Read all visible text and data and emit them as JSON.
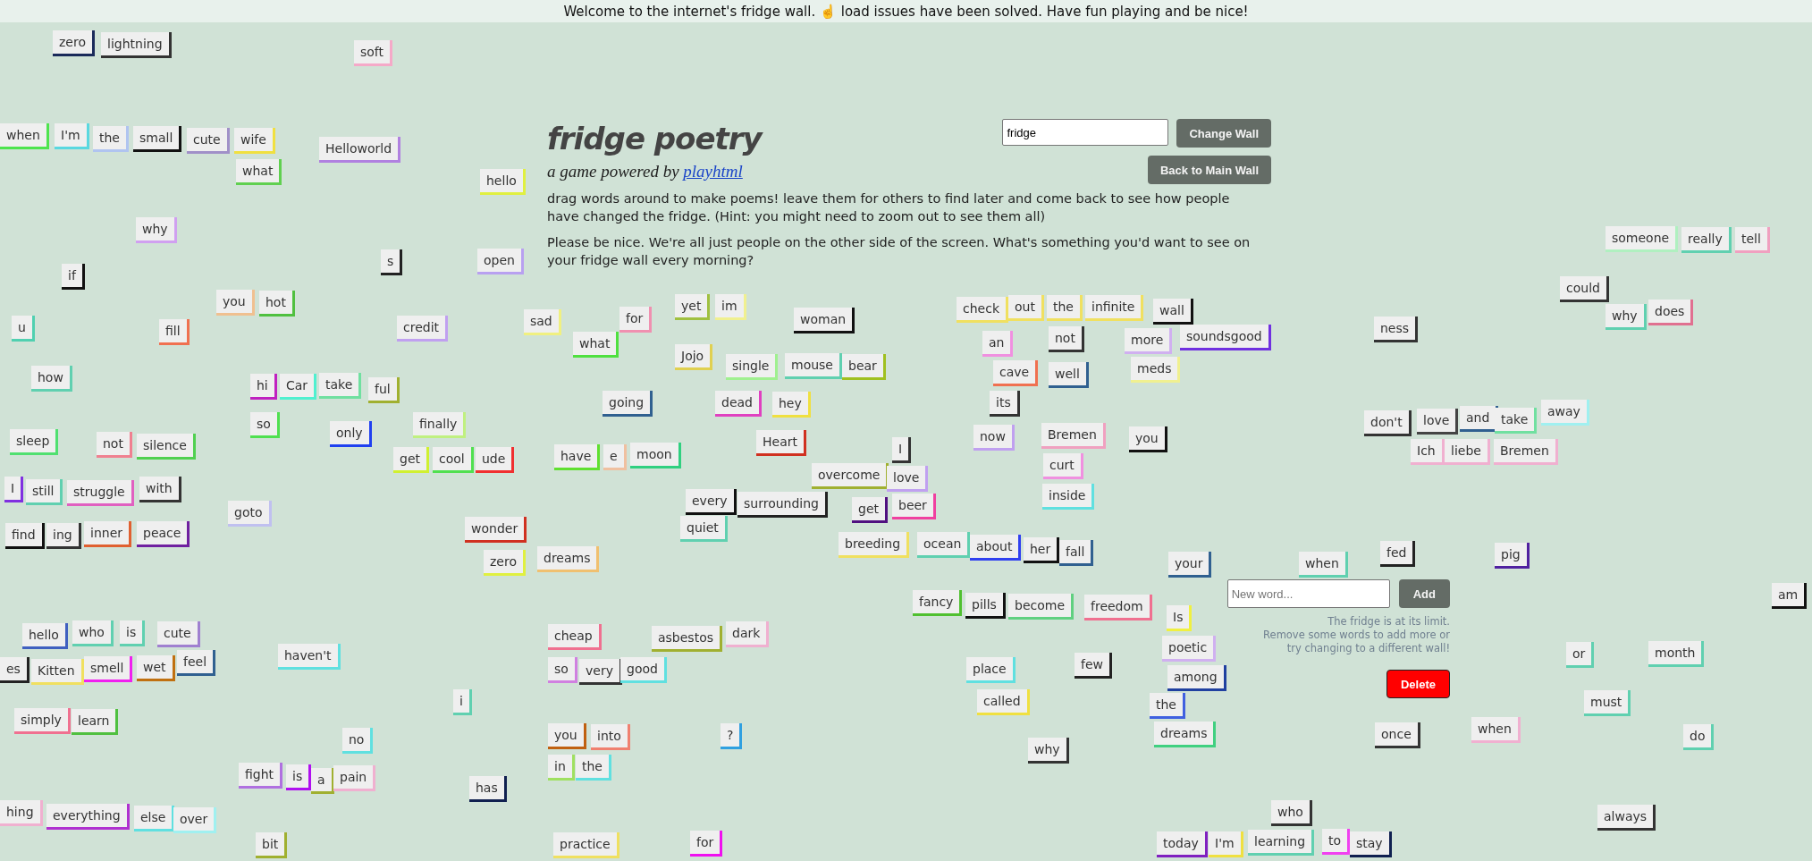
{
  "banner": "Welcome to the internet's fridge wall. ☝️ load issues have been solved. Have fun playing and be nice!",
  "intro": {
    "title": "fridge poetry",
    "subtitle": "a game powered by ",
    "link": "playhtml",
    "paragraphs": [
      "drag words around to make poems! leave them for others to find later and come back to see how people have changed the fridge. (Hint: you might need to zoom out to see them all)",
      "Please be nice. We're all just people on the other side of the screen. What's something you'd want to see on your fridge wall every morning?"
    ]
  },
  "wall_controls": {
    "wall_value": "fridge",
    "change_button": "Change Wall",
    "main_button": "Back to Main Wall"
  },
  "words": [
    {
      "text": "zero",
      "color": "#1a2a5a"
    },
    {
      "text": "lightning",
      "color": "#333333"
    },
    {
      "text": "soft",
      "color": "#f5a9c8"
    },
    {
      "text": "when",
      "color": "#4ee44e"
    },
    {
      "text": "I'm",
      "color": "#5ad8e0"
    },
    {
      "text": "the",
      "color": "#b0c4f0"
    },
    {
      "text": "small",
      "color": "#111111"
    },
    {
      "text": "cute",
      "color": "#a090c8"
    },
    {
      "text": "wife",
      "color": "#f0e040"
    },
    {
      "text": "what",
      "color": "#60d050"
    },
    {
      "text": "Helloworld",
      "color": "#b080e0"
    },
    {
      "text": "hello",
      "color": "#e0f040"
    },
    {
      "text": "why",
      "color": "#d0a0f0"
    },
    {
      "text": "s",
      "color": "#222222"
    },
    {
      "text": "open",
      "color": "#b8a0f0"
    },
    {
      "text": "if",
      "color": "#111111"
    },
    {
      "text": "you",
      "color": "#f0c090"
    },
    {
      "text": "hot",
      "color": "#50c040"
    },
    {
      "text": "u",
      "color": "#50d0b0"
    },
    {
      "text": "fill",
      "color": "#f07050"
    },
    {
      "text": "credit",
      "color": "#c0a0f0"
    },
    {
      "text": "sad",
      "color": "#f0f080"
    },
    {
      "text": "for",
      "color": "#f090b0"
    },
    {
      "text": "yet",
      "color": "#a0c040"
    },
    {
      "text": "im",
      "color": "#f0f090"
    },
    {
      "text": "woman",
      "color": "#111111"
    },
    {
      "text": "what",
      "color": "#50e040"
    },
    {
      "text": "Jojo",
      "color": "#e0d050"
    },
    {
      "text": "single",
      "color": "#a0f090"
    },
    {
      "text": "mouse",
      "color": "#60d0b0"
    },
    {
      "text": "bear",
      "color": "#a0c020"
    },
    {
      "text": "how",
      "color": "#60d0b0"
    },
    {
      "text": "hi",
      "color": "#c020c0"
    },
    {
      "text": "Car",
      "color": "#50f0d0"
    },
    {
      "text": "take",
      "color": "#70e0a0"
    },
    {
      "text": "ful",
      "color": "#a0b030"
    },
    {
      "text": "going",
      "color": "#306090"
    },
    {
      "text": "dead",
      "color": "#e040c0"
    },
    {
      "text": "hey",
      "color": "#f0e040"
    },
    {
      "text": "so",
      "color": "#50e050"
    },
    {
      "text": "only",
      "color": "#2040f0"
    },
    {
      "text": "finally",
      "color": "#c0f080"
    },
    {
      "text": "sleep",
      "color": "#50e070"
    },
    {
      "text": "check",
      "color": "#f0e060"
    },
    {
      "text": "out",
      "color": "#f0e060"
    },
    {
      "text": "the",
      "color": "#f0e060"
    },
    {
      "text": "infinite",
      "color": "#f0e060"
    },
    {
      "text": "wall",
      "color": "#111111"
    },
    {
      "text": "not",
      "color": "#333333"
    },
    {
      "text": "an",
      "color": "#f090e0"
    },
    {
      "text": "more",
      "color": "#d0b0f0"
    },
    {
      "text": "soundsgood",
      "color": "#7030e0"
    },
    {
      "text": "meds",
      "color": "#f0f090"
    },
    {
      "text": "cave",
      "color": "#f07050"
    },
    {
      "text": "well",
      "color": "#306090"
    },
    {
      "text": "its",
      "color": "#333333"
    },
    {
      "text": "now",
      "color": "#c0a0f0"
    },
    {
      "text": "Bremen",
      "color": "#f0a0c0"
    },
    {
      "text": "you",
      "color": "#111111"
    },
    {
      "text": "someone",
      "color": "#b0f0c0"
    },
    {
      "text": "really",
      "color": "#60d0b0"
    },
    {
      "text": "tell",
      "color": "#f0a0c0"
    },
    {
      "text": "could",
      "color": "#333333"
    },
    {
      "text": "why",
      "color": "#60d0b0"
    },
    {
      "text": "does",
      "color": "#e07090"
    },
    {
      "text": "ness",
      "color": "#333333"
    },
    {
      "text": "don't",
      "color": "#333333"
    },
    {
      "text": "love",
      "color": "#444444"
    },
    {
      "text": "and",
      "color": "#306090"
    },
    {
      "text": "take",
      "color": "#70e0a0"
    },
    {
      "text": "away",
      "color": "#a0f0f0"
    },
    {
      "text": "not",
      "color": "#f08090"
    },
    {
      "text": "silence",
      "color": "#50d050"
    },
    {
      "text": "I",
      "color": "#8030e0"
    },
    {
      "text": "still",
      "color": "#60d0b0"
    },
    {
      "text": "struggle",
      "color": "#e060c0"
    },
    {
      "text": "with",
      "color": "#333333"
    },
    {
      "text": "goto",
      "color": "#c0c0f0"
    },
    {
      "text": "find",
      "color": "#111111"
    },
    {
      "text": "ing",
      "color": "#333333"
    },
    {
      "text": "inner",
      "color": "#e06030"
    },
    {
      "text": "peace",
      "color": "#7020a0"
    },
    {
      "text": "get",
      "color": "#d0f030"
    },
    {
      "text": "cool",
      "color": "#50e050"
    },
    {
      "text": "ude",
      "color": "#f03030"
    },
    {
      "text": "have",
      "color": "#60e030"
    },
    {
      "text": "e",
      "color": "#f0c0a0"
    },
    {
      "text": "moon",
      "color": "#30d080"
    },
    {
      "text": "every",
      "color": "#111111"
    },
    {
      "text": "Heart",
      "color": "#d03020"
    },
    {
      "text": "I",
      "color": "#333333"
    },
    {
      "text": "surrounding",
      "color": "#222222"
    },
    {
      "text": "overcome",
      "color": "#a0b030"
    },
    {
      "text": "love",
      "color": "#c0a0f0"
    },
    {
      "text": "get",
      "color": "#501080"
    },
    {
      "text": "beer",
      "color": "#f040a0"
    },
    {
      "text": "wonder",
      "color": "#d03020"
    },
    {
      "text": "quiet",
      "color": "#60d0b0"
    },
    {
      "text": "breeding",
      "color": "#f0e060"
    },
    {
      "text": "zero",
      "color": "#e0f040"
    },
    {
      "text": "dreams",
      "color": "#f0c070"
    },
    {
      "text": "hello",
      "color": "#4060c0"
    },
    {
      "text": "who",
      "color": "#60d0b0"
    },
    {
      "text": "is",
      "color": "#60d0b0"
    },
    {
      "text": "feel",
      "color": "#306090"
    },
    {
      "text": "cute",
      "color": "#a080d0"
    },
    {
      "text": "haven't",
      "color": "#60e0e0"
    },
    {
      "text": "es",
      "color": "#222222"
    },
    {
      "text": "Kitten",
      "color": "#f0e060"
    },
    {
      "text": "smell",
      "color": "#f020f0"
    },
    {
      "text": "wet",
      "color": "#c07010"
    },
    {
      "text": "simply",
      "color": "#f07090"
    },
    {
      "text": "learn",
      "color": "#50c040"
    },
    {
      "text": "cheap",
      "color": "#f07090"
    },
    {
      "text": "asbestos",
      "color": "#a0b030"
    },
    {
      "text": "dark",
      "color": "#f0b0d0"
    },
    {
      "text": "so",
      "color": "#d080e0"
    },
    {
      "text": "very",
      "color": "#333333"
    },
    {
      "text": "good",
      "color": "#60e0e0"
    },
    {
      "text": "i",
      "color": "#60d0b0"
    },
    {
      "text": "no",
      "color": "#60e0e0"
    },
    {
      "text": "you",
      "color": "#c06010"
    },
    {
      "text": "into",
      "color": "#f08070"
    },
    {
      "text": "?",
      "color": "#30a0e0"
    },
    {
      "text": "in",
      "color": "#a0e060"
    },
    {
      "text": "the",
      "color": "#60e0e0"
    },
    {
      "text": "fight",
      "color": "#b070e0"
    },
    {
      "text": "is",
      "color": "#b010f0"
    },
    {
      "text": "a",
      "color": "#a0b030"
    },
    {
      "text": "pain",
      "color": "#f0b0d0"
    },
    {
      "text": "has",
      "color": "#102050"
    },
    {
      "text": "hing",
      "color": "#f0b0d0"
    },
    {
      "text": "everything",
      "color": "#b030d0"
    },
    {
      "text": "else",
      "color": "#60e0e0"
    },
    {
      "text": "over",
      "color": "#a0f0f0"
    },
    {
      "text": "bit",
      "color": "#a0b030"
    },
    {
      "text": "practice",
      "color": "#f0e060"
    },
    {
      "text": "for",
      "color": "#f010f0"
    },
    {
      "text": "Ich",
      "color": "#f0b0d0"
    },
    {
      "text": "liebe",
      "color": "#f0b0d0"
    },
    {
      "text": "Bremen",
      "color": "#f0b0d0"
    },
    {
      "text": "curt",
      "color": "#f090e0"
    },
    {
      "text": "inside",
      "color": "#60e0e0"
    },
    {
      "text": "ocean",
      "color": "#60d0b0"
    },
    {
      "text": "about",
      "color": "#3040f0"
    },
    {
      "text": "her",
      "color": "#111111"
    },
    {
      "text": "fall",
      "color": "#306090"
    },
    {
      "text": "your",
      "color": "#306090"
    },
    {
      "text": "when",
      "color": "#60d0b0"
    },
    {
      "text": "fed",
      "color": "#222222"
    },
    {
      "text": "pig",
      "color": "#5020a0"
    },
    {
      "text": "am",
      "color": "#111111"
    },
    {
      "text": "fancy",
      "color": "#50c030"
    },
    {
      "text": "pills",
      "color": "#111111"
    },
    {
      "text": "become",
      "color": "#60d080"
    },
    {
      "text": "freedom",
      "color": "#f07090"
    },
    {
      "text": "Is",
      "color": "#f0f040"
    },
    {
      "text": "poetic",
      "color": "#d0b0f0"
    },
    {
      "text": "among",
      "color": "#2040a0"
    },
    {
      "text": "the",
      "color": "#4060e0"
    },
    {
      "text": "dreams",
      "color": "#40d080"
    },
    {
      "text": "place",
      "color": "#60e0e0"
    },
    {
      "text": "called",
      "color": "#f0e040"
    },
    {
      "text": "few",
      "color": "#222222"
    },
    {
      "text": "why",
      "color": "#333333"
    },
    {
      "text": "or",
      "color": "#60d0b0"
    },
    {
      "text": "month",
      "color": "#60d0b0"
    },
    {
      "text": "must",
      "color": "#60d0b0"
    },
    {
      "text": "once",
      "color": "#333333"
    },
    {
      "text": "when",
      "color": "#f0b0d0"
    },
    {
      "text": "do",
      "color": "#60d0b0"
    },
    {
      "text": "always",
      "color": "#333333"
    },
    {
      "text": "who",
      "color": "#333333"
    },
    {
      "text": "today",
      "color": "#8020c0"
    },
    {
      "text": "I'm",
      "color": "#f0e040"
    },
    {
      "text": "learning",
      "color": "#60d0b0"
    },
    {
      "text": "to",
      "color": "#f040f0"
    },
    {
      "text": "stay",
      "color": "#102050"
    }
  ],
  "new_word": {
    "placeholder": "New word...",
    "add_button": "Add",
    "limit_lines": [
      "The fridge is at its limit.",
      "Remove some words to add more or",
      "try changing to a different wall!"
    ],
    "delete_button": "Delete"
  }
}
